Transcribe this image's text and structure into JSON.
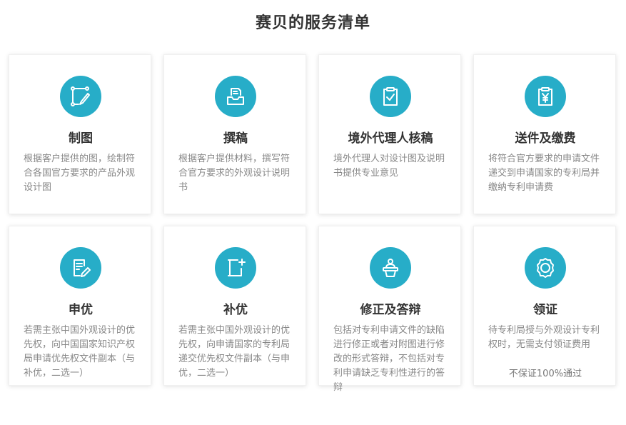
{
  "page": {
    "title": "赛贝的服务清单"
  },
  "colors": {
    "accent": "#27adc8",
    "title": "#333333",
    "text": "#888888"
  },
  "services": [
    {
      "title": "制图",
      "icon": "draw-square-pen-icon",
      "desc": "根据客户提供的图，绘制符合各国官方要求的产品外观设计图"
    },
    {
      "title": "撰稿",
      "icon": "inbox-document-icon",
      "desc": "根据客户提供材料，撰写符合官方要求的外观设计说明书"
    },
    {
      "title": "境外代理人核稿",
      "icon": "clipboard-check-icon",
      "desc": "境外代理人对设计图及说明书提供专业意见"
    },
    {
      "title": "送件及缴费",
      "icon": "yen-document-icon",
      "desc": "将符合官方要求的申请文件递交到申请国家的专利局并缴纳专利申请费"
    },
    {
      "title": "申优",
      "icon": "edit-document-icon",
      "desc": "若需主张中国外观设计的优先权，向中国国家知识产权局申请优先权文件副本（与补优，二选一）"
    },
    {
      "title": "补优",
      "icon": "add-document-icon",
      "desc": "若需主张中国外观设计的优先权，向申请国家的专利局递交优先权文件副本（与申优，二选一）"
    },
    {
      "title": "修正及答辩",
      "icon": "speaker-podium-icon",
      "desc": "包括对专利申请文件的缺陷进行修正或者对附图进行修改的形式答辩，不包括对专利申请缺乏专利性进行的答辩"
    },
    {
      "title": "领证",
      "icon": "certificate-badge-icon",
      "desc": "待专利局授与外观设计专利权时，无需支付领证费用",
      "note": "不保证100%通过"
    }
  ]
}
